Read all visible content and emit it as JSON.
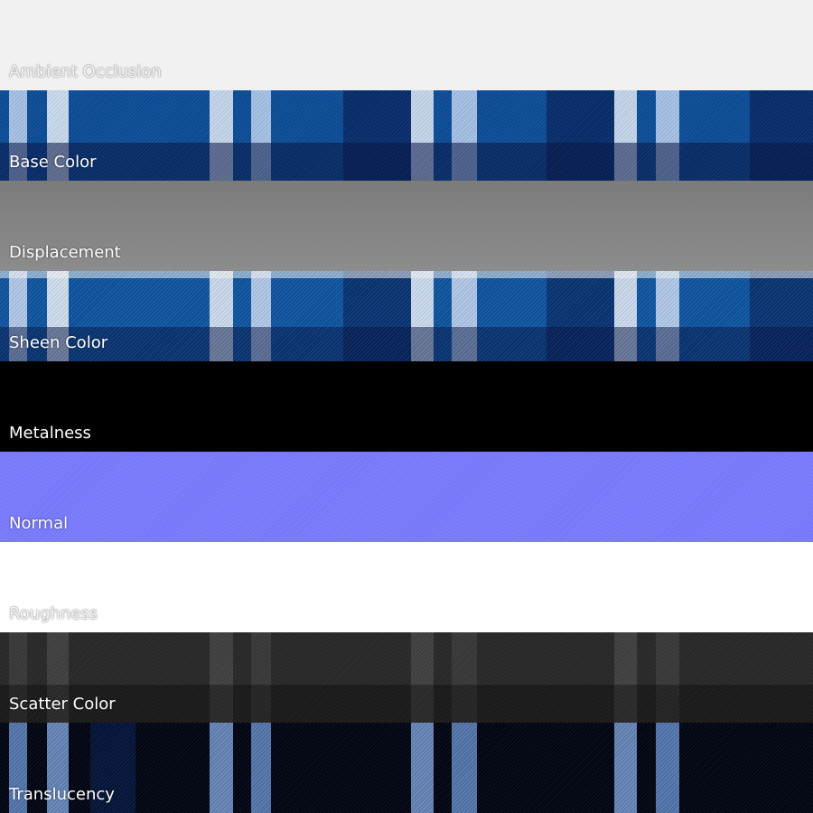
{
  "maps": [
    {
      "label": "Ambient Occlusion",
      "color": "#f1f1f1"
    },
    {
      "label": "Base Color",
      "color": "#0d4f9c"
    },
    {
      "label": "Displacement",
      "color": "#848484"
    },
    {
      "label": "Sheen Color",
      "color": "#0f58a6"
    },
    {
      "label": "Metalness",
      "color": "#000000"
    },
    {
      "label": "Normal",
      "color": "#7a7cfd"
    },
    {
      "label": "Roughness",
      "color": "#ffffff"
    },
    {
      "label": "Scatter Color",
      "color": "#2b2b2b"
    },
    {
      "label": "Translucency",
      "color": "#020614"
    }
  ]
}
